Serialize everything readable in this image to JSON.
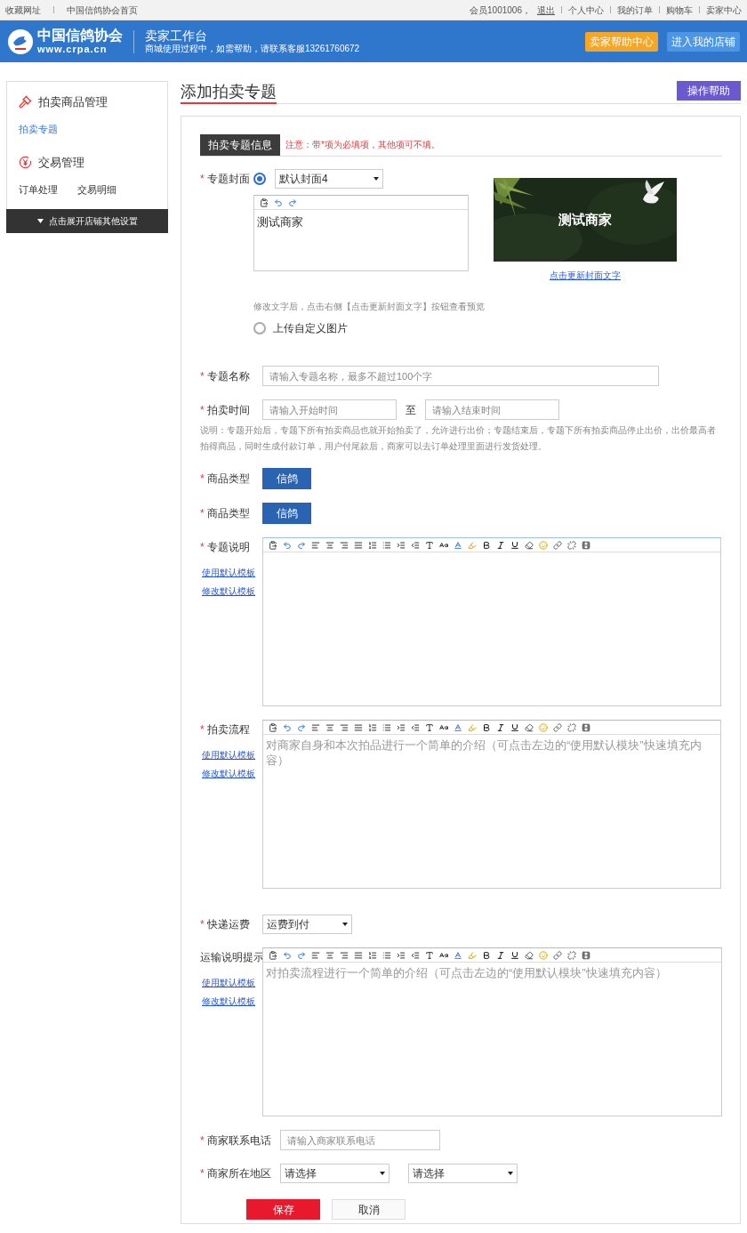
{
  "topbar": {
    "left_links": [
      "收藏网址",
      "中国信鸽协会首页"
    ],
    "member": "会员1001006，",
    "logout": "退出",
    "right_links": [
      "个人中心",
      "我的订单",
      "购物车",
      "卖家中心"
    ]
  },
  "header": {
    "logo_name": "中国信鸽协会",
    "logo_url": "www.crpa.cn",
    "title": "卖家工作台",
    "subtitle": "商城使用过程中，如需帮助，请联系客服13261760672",
    "buttons": [
      {
        "label": "卖家帮助中心",
        "kind": "orange"
      },
      {
        "label": "进入我的店铺",
        "kind": "light"
      }
    ]
  },
  "sidebar": {
    "groups": [
      {
        "title": "拍卖商品管理",
        "items": [
          {
            "label": "拍卖专题",
            "selected": true
          }
        ]
      },
      {
        "title": "交易管理",
        "items": [
          {
            "label": "订单处理",
            "selected": false
          },
          {
            "label": "交易明细",
            "selected": false
          }
        ]
      }
    ],
    "expand": "点击展开店铺其他设置"
  },
  "page_title": "添加拍卖专题",
  "help_button": "操作帮助",
  "form": {
    "section_tab": "拍卖专题信息",
    "notice": "注意：带*项为必填项，其他项可不填。",
    "fields": [
      {
        "kind": "cover",
        "mark": "*",
        "label": "专题封面",
        "default_cover": {
          "selected": true,
          "value": "默认封面4"
        },
        "cover_text": "测试商家",
        "preview_text": "测试商家",
        "update_link": "点击更新封面文字",
        "hint": "修改文字后，点击右侧【点击更新封面文字】按钮查看预览",
        "custom_cover": {
          "selected": false,
          "label": "上传自定义图片"
        }
      },
      {
        "kind": "text",
        "mark": "*",
        "label": "专题名称",
        "placeholder": "请输入专题名称，最多不超过100个字"
      },
      {
        "kind": "time",
        "mark": "*",
        "label": "拍卖时间",
        "start_placeholder": "请输入开始时间",
        "separator": "至",
        "end_placeholder": "请输入结束时间",
        "note": "说明：专题开始后，专题下所有拍卖商品也就开始拍卖了，允许进行出价；专题结束后，专题下所有拍卖商品停止出价，出价最高者拍得商品，同时生成付款订单，用户付尾款后，商家可以去订单处理里面进行发货处理。"
      },
      {
        "kind": "tag",
        "mark": "*",
        "label": "商品类型",
        "value": "信鸽"
      },
      {
        "kind": "tag",
        "mark": "*",
        "label": "商品类型",
        "value": "信鸽"
      },
      {
        "kind": "editor",
        "mark": "*",
        "label": "专题说明",
        "links": [
          "使用默认模板",
          "修改默认模板"
        ]
      },
      {
        "kind": "editor",
        "mark": "*",
        "label": "拍卖流程",
        "links": [
          "使用默认模板",
          "修改默认模板"
        ],
        "placeholder": "对商家自身和本次拍品进行一个简单的介绍（可点击左边的“使用默认模块”快速填充内容）"
      },
      {
        "kind": "select",
        "mark": "*",
        "label": "快递运费",
        "value": "运费到付"
      },
      {
        "kind": "editor",
        "label": "运输说明提示",
        "links": [
          "使用默认模板",
          "修改默认模板"
        ],
        "placeholder": "对拍卖流程进行一个简单的介绍（可点击左边的“使用默认模块”快速填充内容）"
      },
      {
        "kind": "text",
        "mark": "*",
        "label": "商家联系电话",
        "placeholder": "请输入商家联系电话"
      },
      {
        "kind": "region",
        "mark": "*",
        "label": "商家所在地区",
        "values": [
          "请选择",
          "请选择"
        ]
      }
    ],
    "buttons": [
      {
        "label": "保存",
        "kind": "primary"
      },
      {
        "label": "取消",
        "kind": "secondary"
      }
    ]
  }
}
